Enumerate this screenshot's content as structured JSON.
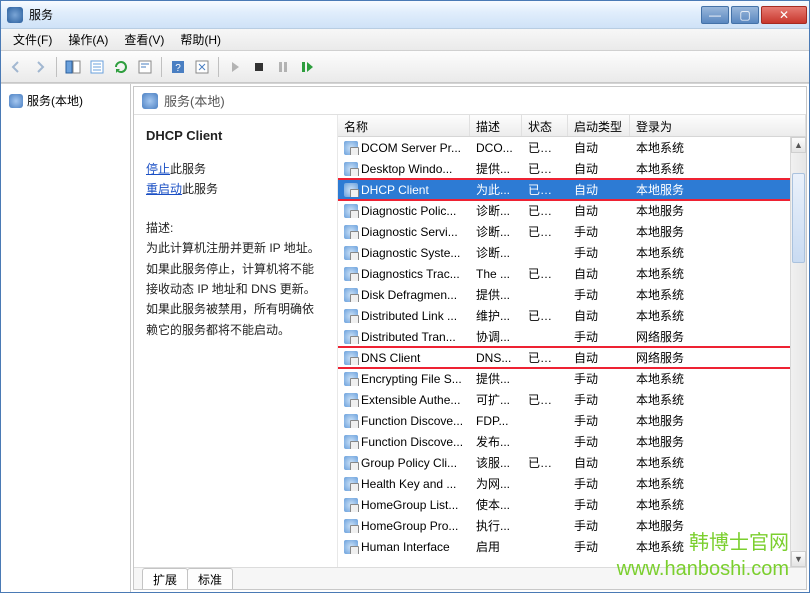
{
  "window": {
    "title": "服务"
  },
  "menu": {
    "file": "文件(F)",
    "action": "操作(A)",
    "view": "查看(V)",
    "help": "帮助(H)"
  },
  "nav": {
    "local_services": "服务(本地)"
  },
  "detail_header": "服务(本地)",
  "selected_service": {
    "title": "DHCP Client",
    "stop_link": "停止",
    "stop_suffix": "此服务",
    "restart_link": "重启动",
    "restart_suffix": "此服务",
    "desc_label": "描述:",
    "desc_text": "为此计算机注册并更新 IP 地址。如果此服务停止，计算机将不能接收动态 IP 地址和 DNS 更新。如果此服务被禁用，所有明确依赖它的服务都将不能启动。"
  },
  "columns": {
    "name": "名称",
    "desc": "描述",
    "status": "状态",
    "startup": "启动类型",
    "logon": "登录为"
  },
  "rows": [
    {
      "name": "DCOM Server Pr...",
      "desc": "DCO...",
      "status": "已启动",
      "startup": "自动",
      "logon": "本地系统"
    },
    {
      "name": "Desktop Windo...",
      "desc": "提供...",
      "status": "已启动",
      "startup": "自动",
      "logon": "本地系统"
    },
    {
      "name": "DHCP Client",
      "desc": "为此...",
      "status": "已启动",
      "startup": "自动",
      "logon": "本地服务",
      "selected": true,
      "highlight": true
    },
    {
      "name": "Diagnostic Polic...",
      "desc": "诊断...",
      "status": "已启动",
      "startup": "自动",
      "logon": "本地服务"
    },
    {
      "name": "Diagnostic Servi...",
      "desc": "诊断...",
      "status": "已启动",
      "startup": "手动",
      "logon": "本地服务"
    },
    {
      "name": "Diagnostic Syste...",
      "desc": "诊断...",
      "status": "",
      "startup": "手动",
      "logon": "本地系统"
    },
    {
      "name": "Diagnostics Trac...",
      "desc": "The ...",
      "status": "已启动",
      "startup": "自动",
      "logon": "本地系统"
    },
    {
      "name": "Disk Defragmen...",
      "desc": "提供...",
      "status": "",
      "startup": "手动",
      "logon": "本地系统"
    },
    {
      "name": "Distributed Link ...",
      "desc": "维护...",
      "status": "已启动",
      "startup": "自动",
      "logon": "本地系统"
    },
    {
      "name": "Distributed Tran...",
      "desc": "协调...",
      "status": "",
      "startup": "手动",
      "logon": "网络服务"
    },
    {
      "name": "DNS Client",
      "desc": "DNS...",
      "status": "已启动",
      "startup": "自动",
      "logon": "网络服务",
      "highlight": true
    },
    {
      "name": "Encrypting File S...",
      "desc": "提供...",
      "status": "",
      "startup": "手动",
      "logon": "本地系统"
    },
    {
      "name": "Extensible Authe...",
      "desc": "可扩...",
      "status": "已启动",
      "startup": "手动",
      "logon": "本地系统"
    },
    {
      "name": "Function Discove...",
      "desc": "FDP...",
      "status": "",
      "startup": "手动",
      "logon": "本地服务"
    },
    {
      "name": "Function Discove...",
      "desc": "发布...",
      "status": "",
      "startup": "手动",
      "logon": "本地服务"
    },
    {
      "name": "Group Policy Cli...",
      "desc": "该服...",
      "status": "已启动",
      "startup": "自动",
      "logon": "本地系统"
    },
    {
      "name": "Health Key and ...",
      "desc": "为网...",
      "status": "",
      "startup": "手动",
      "logon": "本地系统"
    },
    {
      "name": "HomeGroup List...",
      "desc": "使本...",
      "status": "",
      "startup": "手动",
      "logon": "本地系统"
    },
    {
      "name": "HomeGroup Pro...",
      "desc": "执行...",
      "status": "",
      "startup": "手动",
      "logon": "本地服务"
    },
    {
      "name": "Human Interface",
      "desc": "启用",
      "status": "",
      "startup": "手动",
      "logon": "本地系统"
    }
  ],
  "tabs": {
    "extended": "扩展",
    "standard": "标准"
  },
  "watermark": {
    "line1": "韩博士官网",
    "line2": "www.hanboshi.com"
  }
}
